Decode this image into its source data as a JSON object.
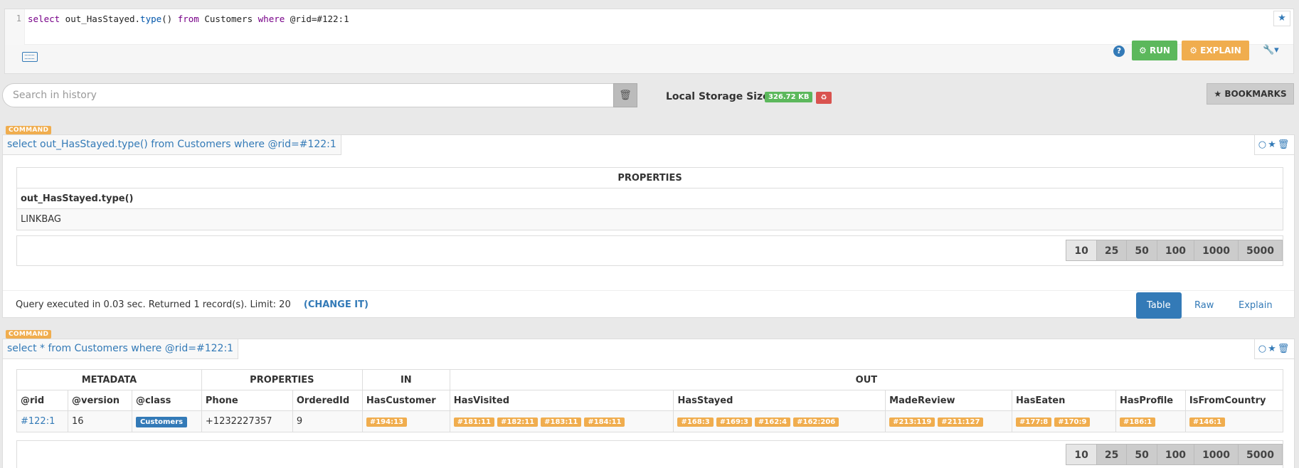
{
  "editor": {
    "line_number": "1",
    "query_tokens": [
      {
        "t": "select",
        "c": "kw"
      },
      {
        "t": " out_HasStayed.",
        "c": ""
      },
      {
        "t": "type",
        "c": "fn"
      },
      {
        "t": "() ",
        "c": ""
      },
      {
        "t": "from",
        "c": "kw"
      },
      {
        "t": " Customers ",
        "c": ""
      },
      {
        "t": "where",
        "c": "kw"
      },
      {
        "t": " @rid=#122:1",
        "c": ""
      }
    ],
    "help_label": "?",
    "run_label": "⚙ RUN",
    "explain_label": "⚙ EXPLAIN",
    "settings_label": "🔧▾",
    "star_icon": "★"
  },
  "history": {
    "search_placeholder": "Search in history",
    "trash_icon": "🗑",
    "storage_label": "Local Storage Size",
    "storage_size": "326.72 KB",
    "storage_clear_icon": "♻",
    "bookmarks_label": "★ BOOKMARKS"
  },
  "commands": [
    {
      "badge": "COMMAND",
      "query": "select out_HasStayed.type() from Customers where @rid=#122:1",
      "icons": "○★🗑",
      "table_group": "PROPERTIES",
      "columns": [
        "out_HasStayed.type()"
      ],
      "rows": [
        [
          "LINKBAG"
        ]
      ],
      "pages": [
        "10",
        "25",
        "50",
        "100",
        "1000",
        "5000"
      ],
      "footer_text": "Query executed in 0.03 sec. Returned 1 record(s). Limit: 20",
      "change_label": "(CHANGE IT)",
      "view_tabs": [
        "Table",
        "Raw",
        "Explain"
      ]
    },
    {
      "badge": "COMMAND",
      "query": "select * from Customers where @rid=#122:1",
      "icons": "○★🗑",
      "groups": [
        "METADATA",
        "PROPERTIES",
        "IN",
        "OUT"
      ],
      "columns": [
        "@rid",
        "@version",
        "@class",
        "Phone",
        "OrderedId",
        "HasCustomer",
        "HasVisited",
        "HasStayed",
        "MadeReview",
        "HasEaten",
        "HasProfile",
        "IsFromCountry"
      ],
      "row": {
        "rid": "#122:1",
        "version": "16",
        "class": "Customers",
        "phone": "+1232227357",
        "ordered_id": "9",
        "has_customer": [
          "#194:13"
        ],
        "has_visited": [
          "#181:11",
          "#182:11",
          "#183:11",
          "#184:11"
        ],
        "has_stayed": [
          "#168:3",
          "#169:3",
          "#162:4",
          "#162:206"
        ],
        "made_review": [
          "#213:119",
          "#211:127"
        ],
        "has_eaten": [
          "#177:8",
          "#170:9"
        ],
        "has_profile": [
          "#186:1"
        ],
        "is_from_country": [
          "#146:1"
        ]
      },
      "pages": [
        "10",
        "25",
        "50",
        "100",
        "1000",
        "5000"
      ]
    }
  ]
}
